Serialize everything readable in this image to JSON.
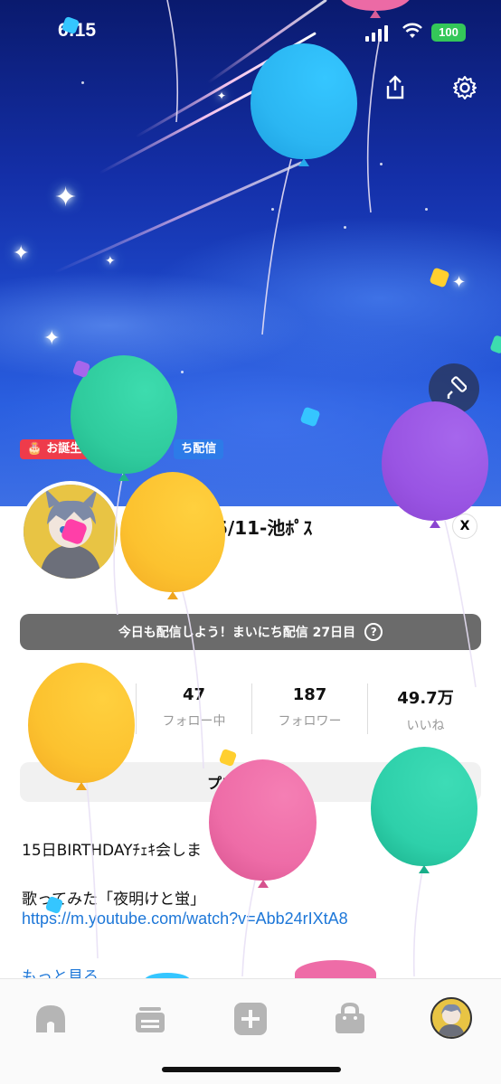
{
  "status_bar": {
    "time": "6:15",
    "battery": "100"
  },
  "header": {
    "qr_icon": "qr-code-icon",
    "share_icon": "share-icon",
    "settings_icon": "gear-icon",
    "edit_header_icon": "paint-roller-icon"
  },
  "badges": [
    {
      "label": "お誕生",
      "icon": "cake-icon",
      "color": "#ee3b4b"
    },
    {
      "label": "ち配信",
      "color": "#2d7be8"
    }
  ],
  "profile": {
    "username": "5/11-池ﾎﾟｽ",
    "x_label": "X",
    "streak_text": "今日も配信しよう！まいにち配信 27日目",
    "streak_help": "?",
    "stats": [
      {
        "number": "47",
        "label": "フォロー中"
      },
      {
        "number": "187",
        "label": "フォロワー"
      },
      {
        "number": "49.7万",
        "label": "いいね"
      }
    ],
    "edit_button": "プロフ　　集",
    "bio_line1": "15日BIRTHDAYﾁｪｷ会しま",
    "bio_line2": "歌ってみた「夜明けと蛍」",
    "link": "https://m.youtube.com/watch?v=Abb24rIXtA8",
    "more": "もっと見る"
  },
  "tabbar": {
    "items": [
      "home-icon",
      "feed-icon",
      "plus-icon",
      "shop-icon",
      "profile-avatar-icon"
    ]
  },
  "colors": {
    "accent_blue": "#1d77d8",
    "streak_gray": "#6b6b6b",
    "battery_green": "#34c759"
  }
}
